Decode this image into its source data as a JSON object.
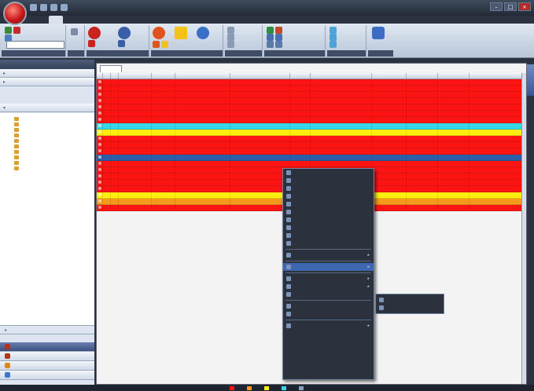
{
  "colors": {
    "red": "#ff1414",
    "cyan": "#36d7e6",
    "yellow": "#ffee10",
    "orange": "#f59a1a",
    "selected": "#2c5fa8"
  },
  "grid": {
    "rows": [
      {
        "color": "red"
      },
      {
        "color": "red"
      },
      {
        "color": "red"
      },
      {
        "color": "red"
      },
      {
        "color": "red"
      },
      {
        "color": "red"
      },
      {
        "color": "red"
      },
      {
        "color": "cyan"
      },
      {
        "color": "yellow"
      },
      {
        "color": "red"
      },
      {
        "color": "red"
      },
      {
        "color": "red"
      },
      {
        "color": "sel"
      },
      {
        "color": "red"
      },
      {
        "color": "red"
      },
      {
        "color": "red"
      },
      {
        "color": "red"
      },
      {
        "color": "red"
      },
      {
        "color": "yellow"
      },
      {
        "color": "orange"
      },
      {
        "color": "red"
      }
    ]
  },
  "context_menu": {
    "items": [
      {
        "icon": "alarm-icon",
        "sep_after": false,
        "submenu": false,
        "hl": false
      },
      {
        "icon": "ack-icon",
        "sep_after": false,
        "submenu": false,
        "hl": false
      },
      {
        "icon": "log-icon",
        "sep_after": false,
        "submenu": false,
        "hl": false
      },
      {
        "icon": "tt-icon",
        "sep_after": false,
        "submenu": false,
        "hl": false
      },
      {
        "icon": "tt-icon",
        "sep_after": false,
        "submenu": false,
        "hl": false
      },
      {
        "icon": "alarm-icon",
        "sep_after": false,
        "submenu": false,
        "hl": false
      },
      {
        "icon": "note-icon",
        "sep_after": false,
        "submenu": false,
        "hl": false
      },
      {
        "icon": "history-icon",
        "sep_after": false,
        "submenu": false,
        "hl": false
      },
      {
        "icon": "alarm-icon",
        "sep_after": false,
        "submenu": false,
        "hl": false
      },
      {
        "icon": "alarm-icon",
        "sep_after": true,
        "submenu": false,
        "hl": false
      },
      {
        "icon": "analysis-icon",
        "sep_after": true,
        "submenu": true,
        "hl": false
      },
      {
        "icon": "note-icon",
        "sep_after": true,
        "submenu": true,
        "hl": true
      },
      {
        "icon": "info-icon",
        "sep_after": false,
        "submenu": true,
        "hl": false
      },
      {
        "icon": "app-icon",
        "sep_after": false,
        "submenu": true,
        "hl": false
      },
      {
        "icon": "alarm-icon",
        "sep_after": true,
        "submenu": false,
        "hl": false
      },
      {
        "icon": "link-icon",
        "sep_after": false,
        "submenu": false,
        "hl": false
      },
      {
        "icon": "link-icon",
        "sep_after": true,
        "submenu": false,
        "hl": false
      },
      {
        "icon": "copy-icon",
        "sep_after": false,
        "submenu": true,
        "hl": false
      }
    ]
  },
  "submenu": {
    "items": [
      {
        "icon": "mark-icon"
      },
      {
        "icon": "mark-icon"
      }
    ]
  },
  "status": {
    "items": [
      {
        "color": "#ff1414"
      },
      {
        "color": "#f59a1a"
      },
      {
        "color": "#ffee10"
      },
      {
        "color": "#36d7e6"
      },
      {
        "color": "#8aa0c0"
      }
    ]
  }
}
